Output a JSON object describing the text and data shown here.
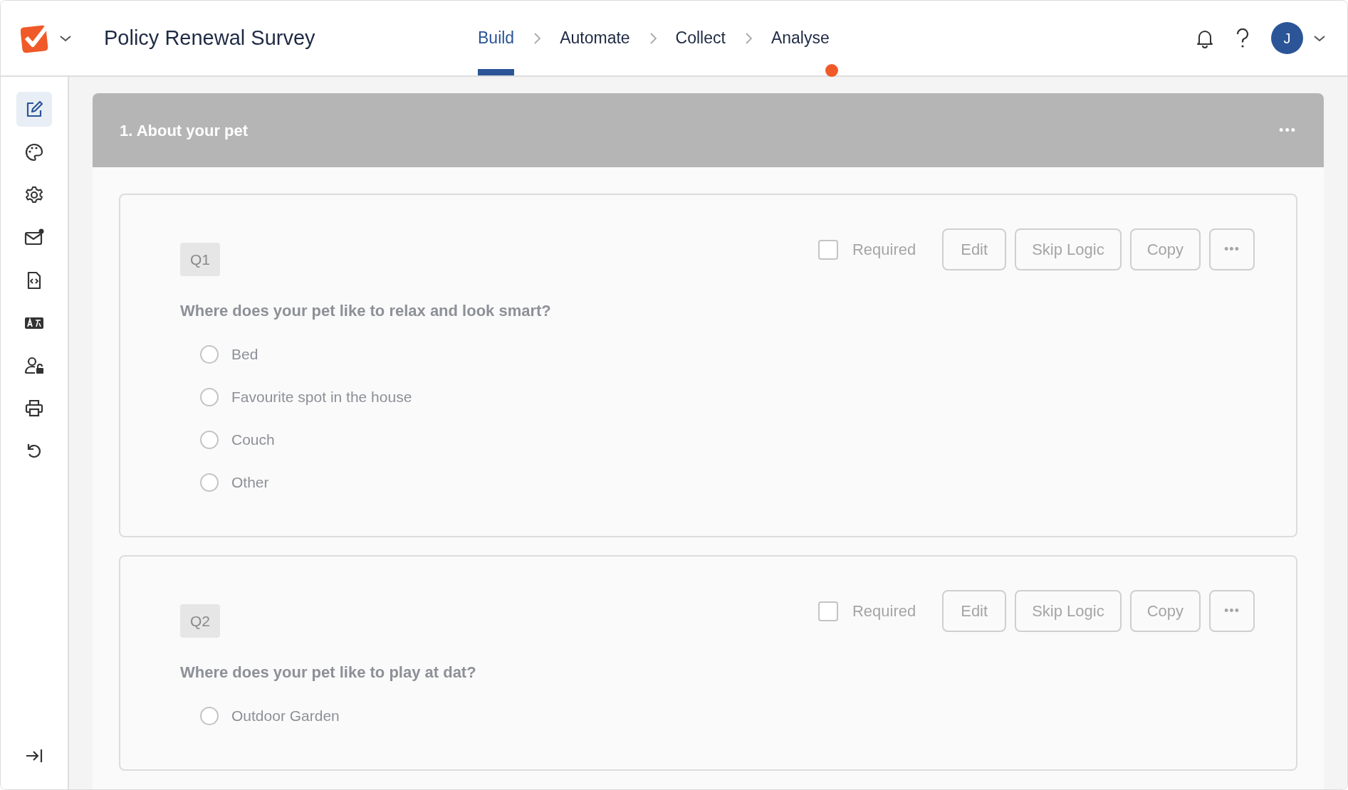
{
  "header": {
    "title": "Policy Renewal Survey",
    "avatar": "J"
  },
  "tabs": [
    {
      "label": "Build",
      "selected": true,
      "indicator": false
    },
    {
      "label": "Automate",
      "selected": false,
      "indicator": false
    },
    {
      "label": "Collect",
      "selected": false,
      "indicator": false
    },
    {
      "label": "Analyse",
      "selected": false,
      "indicator": true
    }
  ],
  "sidebar": {
    "items": [
      {
        "selected": true
      },
      {
        "selected": false
      },
      {
        "selected": false
      },
      {
        "selected": false
      },
      {
        "selected": false
      },
      {
        "selected": false
      },
      {
        "selected": false
      },
      {
        "selected": false
      },
      {
        "selected": false
      }
    ]
  },
  "page": {
    "title": "1. About your pet",
    "more": "•••"
  },
  "questions": [
    {
      "number": "Q1",
      "required": false,
      "required_label": "Required",
      "buttons": [
        "Edit",
        "Skip Logic",
        "Copy"
      ],
      "more": "•••",
      "text": "Where does your pet like to relax and look smart?",
      "options": [
        {
          "label": "Bed",
          "selected": false
        },
        {
          "label": "Favourite spot in the house",
          "selected": false
        },
        {
          "label": "Couch",
          "selected": false
        },
        {
          "label": "Other",
          "selected": false
        }
      ]
    },
    {
      "number": "Q2",
      "required": false,
      "required_label": "Required",
      "buttons": [
        "Edit",
        "Skip Logic",
        "Copy"
      ],
      "more": "•••",
      "text": "Where does your pet like to play at dat?",
      "options": [
        {
          "label": "Outdoor Garden",
          "selected": false
        }
      ]
    }
  ]
}
